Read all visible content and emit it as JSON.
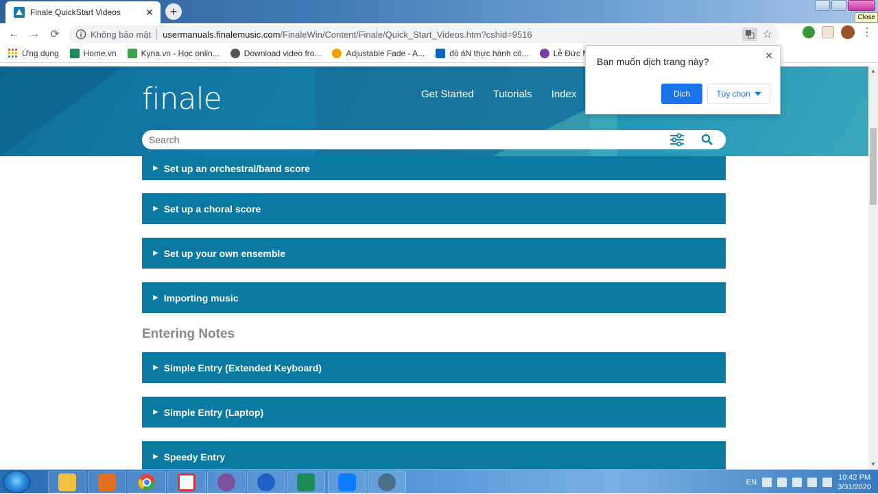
{
  "browser": {
    "tab": {
      "title": "Finale QuickStart Videos",
      "close": "✕"
    },
    "new_tab": "+",
    "close_tooltip": "Close",
    "toolbar": {
      "back": "←",
      "forward": "→",
      "reload": "⟳",
      "security_label": "Không bảo mật",
      "url_host": "usermanuals.finalemusic.com",
      "url_path": "/FinaleWin/Content/Finale/Quick_Start_Videos.htm?cshid=9516",
      "star": "☆",
      "menu": "⋮"
    },
    "bookmarks": [
      {
        "label": "Ứng dụng",
        "color": "#e8453c"
      },
      {
        "label": "Home.vn",
        "color": "#1c8b5a"
      },
      {
        "label": "Kyna.vn - Học onlin...",
        "color": "#3aa34a"
      },
      {
        "label": "Download video fro...",
        "color": "#555555"
      },
      {
        "label": "Adjustable Fade - A...",
        "color": "#f2a000"
      },
      {
        "label": "đồ áN thực hành cô...",
        "color": "#0a66c2"
      },
      {
        "label": "Lễ Đức Mẹ Mâ",
        "color": "#7a3fa0"
      }
    ]
  },
  "translate_popup": {
    "question": "Bạn muốn dịch trang này?",
    "close": "✕",
    "translate_label": "Dịch",
    "options_label": "Tùy chọn"
  },
  "site": {
    "logo": "finale",
    "logo_mark": ".",
    "nav": [
      "Get Started",
      "Tutorials",
      "Index"
    ],
    "search_placeholder": "Search",
    "sections": [
      {
        "items": [
          "Set up an orchestral/band score",
          "Set up a choral score",
          "Set up your own ensemble",
          "Importing music"
        ]
      },
      {
        "title": "Entering Notes",
        "items": [
          "Simple Entry (Extended Keyboard)",
          "Simple Entry (Laptop)",
          "Speedy Entry"
        ]
      }
    ],
    "accordion_marker": "▶",
    "accent": "#0a7aa2"
  },
  "taskbar": {
    "apps": [
      {
        "name": "explorer",
        "color": "#f0c040"
      },
      {
        "name": "media-player",
        "color": "#e07020"
      },
      {
        "name": "chrome",
        "color": "#e94235"
      },
      {
        "name": "foxit",
        "color": "#d23a3a"
      },
      {
        "name": "viber",
        "color": "#7b519d"
      },
      {
        "name": "audacity",
        "color": "#1f5fc8"
      },
      {
        "name": "home-vn",
        "color": "#1c8b5a"
      },
      {
        "name": "zalo",
        "color": "#0b7bff"
      },
      {
        "name": "app-9",
        "color": "#4a6f8a"
      }
    ],
    "lang": "EN",
    "time": "10:42 PM",
    "date": "3/31/2020"
  }
}
